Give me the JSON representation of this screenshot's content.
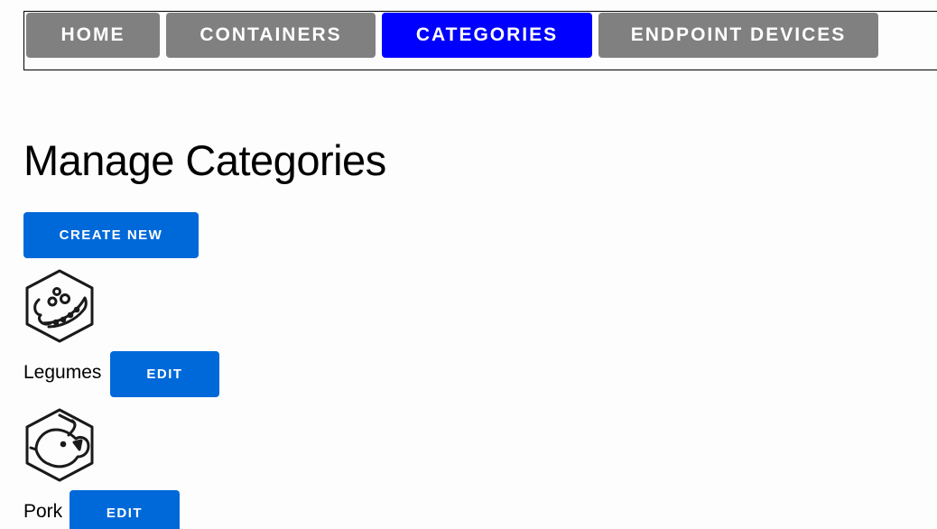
{
  "nav": {
    "items": [
      {
        "label": "HOME",
        "active": false
      },
      {
        "label": "CONTAINERS",
        "active": false
      },
      {
        "label": "CATEGORIES",
        "active": true
      },
      {
        "label": "ENDPOINT DEVICES",
        "active": false
      }
    ],
    "colors": {
      "active": "#0000ff",
      "inactive": "#808080"
    }
  },
  "main": {
    "title": "Manage Categories",
    "create_label": "CREATE NEW",
    "categories": [
      {
        "name": "Legumes",
        "icon": "legumes-icon",
        "edit_label": "EDIT"
      },
      {
        "name": "Pork",
        "icon": "pig-icon",
        "edit_label": "EDIT"
      }
    ]
  },
  "colors": {
    "primary_button": "#0069d9"
  }
}
